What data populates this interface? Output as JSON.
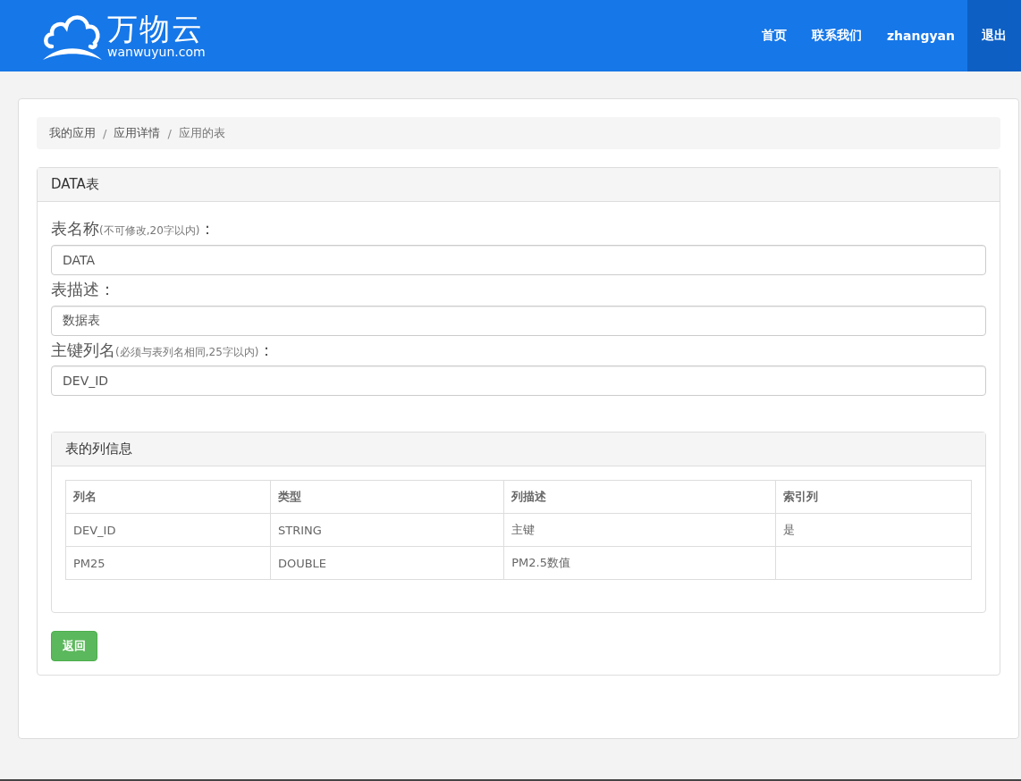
{
  "header": {
    "logo_text": "万物云",
    "logo_domain": "wanwuyun.com",
    "nav": [
      {
        "label": "首页",
        "selected": false
      },
      {
        "label": "联系我们",
        "selected": false
      },
      {
        "label": "zhangyan",
        "selected": false
      },
      {
        "label": "退出",
        "selected": true
      }
    ]
  },
  "breadcrumb": [
    {
      "label": "我的应用"
    },
    {
      "separator": "/",
      "label": "应用详情"
    },
    {
      "separator": "/",
      "label": "应用的表"
    }
  ],
  "panel": {
    "title": "DATA表",
    "fields": [
      {
        "label": "表名称",
        "hint": "(不可修改,20字以内)",
        "suffix": "：",
        "value": "DATA"
      },
      {
        "label": "表描述",
        "suffix": "：",
        "value": "数据表"
      },
      {
        "label": "主键列名",
        "hint": "(必须与表列名相同,25字以内)",
        "suffix": "：",
        "value": "DEV_ID"
      }
    ],
    "columns_panel": {
      "title": "表的列信息",
      "table": {
        "columns": [
          "列名",
          "类型",
          "列描述",
          "索引列"
        ],
        "rows": [
          {
            "cells": [
              "DEV_ID",
              "STRING",
              "主键",
              "是"
            ]
          },
          {
            "cells": [
              "PM25",
              "DOUBLE",
              "PM2.5数值"
            ]
          }
        ]
      }
    },
    "back_button": "返回"
  }
}
